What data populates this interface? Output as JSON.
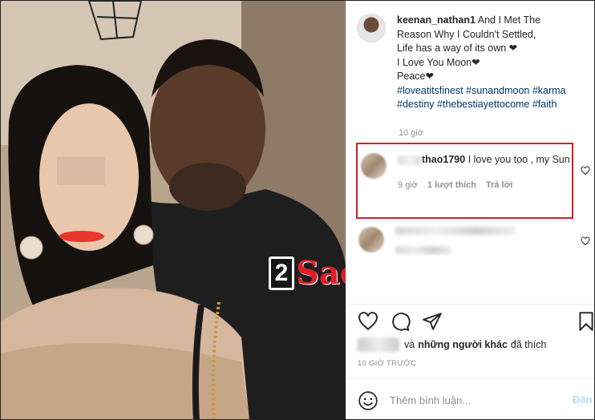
{
  "post": {
    "username": "keenan_nathan1",
    "caption_lines": [
      "And I Met The",
      "Reason Why I Couldn't Settled,",
      "Life has a way of its own ❤",
      "I Love You Moon❤",
      "Peace❤"
    ],
    "hashtags_line1": "#loveatitsfinest #sunandmoon #karma",
    "hashtags_line2": "#destiny #thebestiayettocome #faith",
    "time_ago": "10 giờ"
  },
  "watermark": {
    "box": "2",
    "text": "Sao"
  },
  "comments": [
    {
      "username": "thao1790",
      "text": "I love you too , my Sun",
      "time": "9 giờ",
      "likes": "1 lượt thích",
      "reply": "Trả lời",
      "highlighted_color": "#d0202a"
    }
  ],
  "likes": {
    "text": "và",
    "bold": "những người khác",
    "suffix": "đã thích"
  },
  "timestamp": "10 GIỜ TRƯỚC",
  "comment_box": {
    "placeholder": "Thêm bình luận...",
    "post_label": "Đăn"
  },
  "icons": [
    "heart-icon",
    "comment-icon",
    "share-icon",
    "bookmark-icon",
    "emoji-icon"
  ],
  "colors": {
    "link": "#00376b",
    "muted": "#8e8e8e",
    "highlight": "#d0202a",
    "post_button": "#b2dffc"
  }
}
